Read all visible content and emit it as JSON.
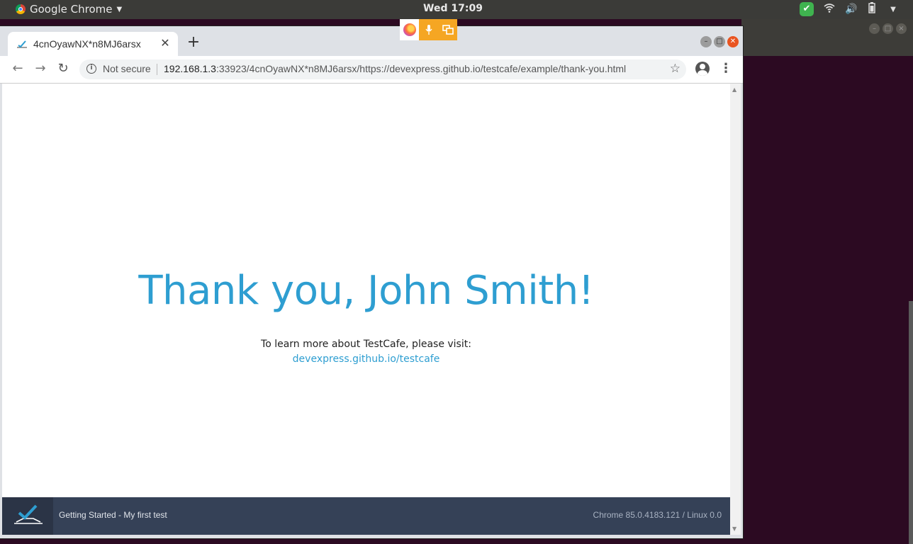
{
  "topbar": {
    "app_name": "Google Chrome",
    "clock": "Wed 17:09"
  },
  "chrome": {
    "tab_title": "4cnOyawNX*n8MJ6arsx",
    "not_secure": "Not secure",
    "url_host": "192.168.1.3",
    "url_rest": ":33923/4cnOyawNX*n8MJ6arsx/https://devexpress.github.io/testcafe/example/thank-you.html"
  },
  "page": {
    "heading": "Thank you, John Smith!",
    "learn_text": "To learn more about TestCafe, please visit:",
    "link_text": "devexpress.github.io/testcafe"
  },
  "testcafe_bar": {
    "test_name": "Getting Started - My first test",
    "user_agent": "Chrome 85.0.4183.121 / Linux 0.0"
  },
  "colors": {
    "accent": "#2e9ed1",
    "status_bar": "#354157",
    "desktop": "#2c0a22"
  }
}
